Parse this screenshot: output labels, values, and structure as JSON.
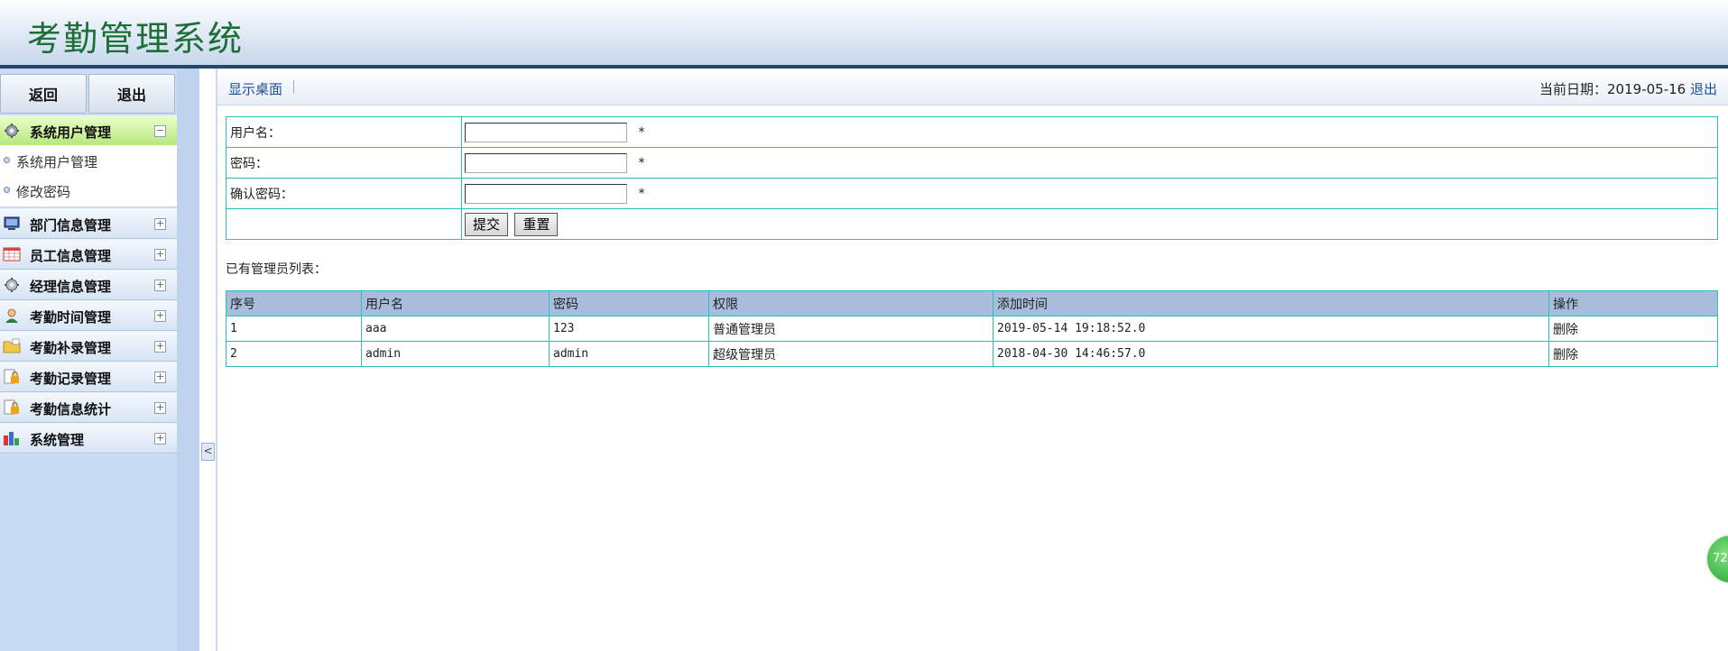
{
  "header": {
    "title": "考勤管理系统"
  },
  "sidebar": {
    "top_buttons": {
      "back": "返回",
      "exit": "退出"
    },
    "active_group": {
      "label": "系统用户管理",
      "toggle": "−"
    },
    "sub_items": [
      "系统用户管理",
      "修改密码"
    ],
    "groups": [
      {
        "label": "部门信息管理",
        "icon": "monitor-icon",
        "toggle": "+"
      },
      {
        "label": "员工信息管理",
        "icon": "table-icon",
        "toggle": "+"
      },
      {
        "label": "经理信息管理",
        "icon": "gear-icon",
        "toggle": "+"
      },
      {
        "label": "考勤时间管理",
        "icon": "user-icon",
        "toggle": "+"
      },
      {
        "label": "考勤补录管理",
        "icon": "folder-icon",
        "toggle": "+"
      },
      {
        "label": "考勤记录管理",
        "icon": "lock-doc-icon",
        "toggle": "+"
      },
      {
        "label": "考勤信息统计",
        "icon": "lock-doc-icon",
        "toggle": "+"
      },
      {
        "label": "系统管理",
        "icon": "chart-icon",
        "toggle": "+"
      }
    ],
    "collapse_glyph": "<"
  },
  "toolbar": {
    "show_desktop": "显示桌面",
    "date_label": "当前日期：",
    "date_value": "2019-05-16",
    "logout": "退出"
  },
  "form": {
    "username_label": "用户名：",
    "password_label": "密码：",
    "confirm_label": "确认密码：",
    "username_value": "",
    "password_value": "",
    "confirm_value": "",
    "required_mark": "*",
    "submit_label": "提交",
    "reset_label": "重置"
  },
  "admin_list": {
    "caption": "已有管理员列表：",
    "columns": [
      "序号",
      "用户名",
      "密码",
      "权限",
      "添加时间",
      "操作"
    ],
    "rows": [
      [
        "1",
        "aaa",
        "123",
        "普通管理员",
        "2019-05-14 19:18:52.0",
        "删除"
      ],
      [
        "2",
        "admin",
        "admin",
        "超级管理员",
        "2018-04-30 14:46:57.0",
        "删除"
      ]
    ]
  },
  "floating_badge": "72",
  "colors": {
    "title_green": "#1e6e37",
    "header_bar": "#25466f",
    "table_border": "#2cbfbd",
    "table_head": "#a8bcdc"
  }
}
